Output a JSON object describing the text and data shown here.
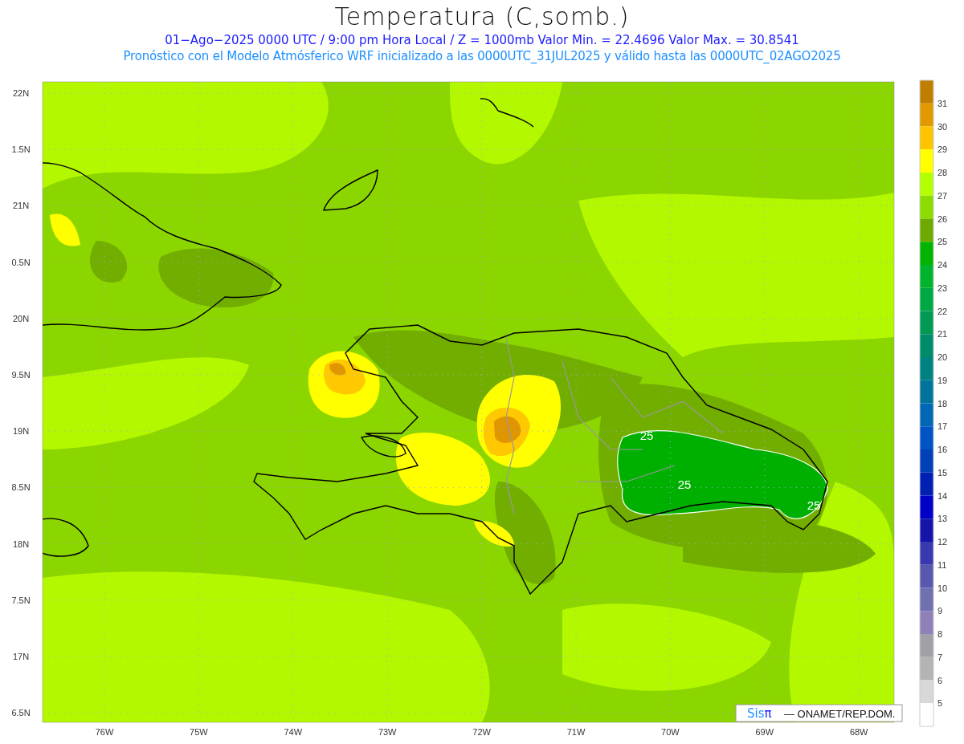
{
  "title": "Temperatura (C,somb.)",
  "subtitle": "01−Ago−2025  0000 UTC / 9:00 pm Hora Local / Z = 1000mb   Valor Min. = 22.4696  Valor Max. = 30.8541",
  "forecast_note": "Pronóstico con el Modelo Atmósferico WRF inicializado a las 0000UTC_31JUL2025 y válido hasta las  0000UTC_02AGO2025",
  "map": {
    "y_ticks": [
      "22N",
      "1.5N",
      "21N",
      "0.5N",
      "20N",
      "9.5N",
      "19N",
      "8.5N",
      "18N",
      "7.5N",
      "17N",
      "6.5N"
    ],
    "x_ticks": [
      "76W",
      "75W",
      "74W",
      "73W",
      "72W",
      "71W",
      "70W",
      "69W",
      "68W"
    ],
    "contour_labels": [
      "25",
      "25",
      "25"
    ],
    "credit": {
      "logo": "Sis",
      "logo_symbol": "π",
      "text": "— ONAMET/REP.DOM."
    }
  },
  "colorbar": {
    "bins": [
      {
        "color": "#c07e00"
      },
      {
        "color": "#e09a00"
      },
      {
        "color": "#ffc400"
      },
      {
        "color": "#ffff00"
      },
      {
        "color": "#b4ff00"
      },
      {
        "color": "#8cdc00"
      },
      {
        "color": "#6eaa00"
      },
      {
        "color": "#00b400"
      },
      {
        "color": "#00b42c"
      },
      {
        "color": "#00a844"
      },
      {
        "color": "#009a52"
      },
      {
        "color": "#008c6a"
      },
      {
        "color": "#008282"
      },
      {
        "color": "#00749a"
      },
      {
        "color": "#0068b4"
      },
      {
        "color": "#0054c4"
      },
      {
        "color": "#0040b8"
      },
      {
        "color": "#0020b4"
      },
      {
        "color": "#0000c8"
      },
      {
        "color": "#1414aa"
      },
      {
        "color": "#3838b0"
      },
      {
        "color": "#5858b0"
      },
      {
        "color": "#7070b0"
      },
      {
        "color": "#9080b8"
      },
      {
        "color": "#a0a0a8"
      },
      {
        "color": "#b4b4b4"
      },
      {
        "color": "#d8d8d8"
      },
      {
        "color": "#ffffff"
      }
    ],
    "labels": [
      "31",
      "30",
      "29",
      "28",
      "27",
      "26",
      "25",
      "24",
      "23",
      "22",
      "21",
      "20",
      "19",
      "18",
      "17",
      "16",
      "15",
      "14",
      "13",
      "12",
      "11",
      "10",
      "9",
      "8",
      "7",
      "6",
      "5"
    ]
  }
}
